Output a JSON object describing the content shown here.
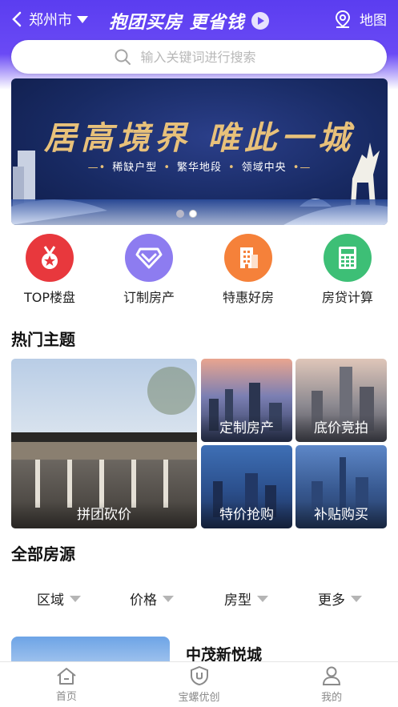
{
  "header": {
    "city": "郑州市",
    "slogan": "抱团买房 更省钱",
    "map_label": "地图"
  },
  "search": {
    "placeholder": "输入关键词进行搜索"
  },
  "banner": {
    "title": "居高境界 唯此一城",
    "tags": [
      "稀缺户型",
      "繁华地段",
      "领域中央"
    ],
    "slide_count": 2,
    "active_slide": 2
  },
  "quick_menu": [
    {
      "label": "TOP楼盘",
      "icon": "medal-icon",
      "color": "#e8383d"
    },
    {
      "label": "订制房产",
      "icon": "diamond-icon",
      "color": "#8d7cf0"
    },
    {
      "label": "特惠好房",
      "icon": "building-icon",
      "color": "#f5813a"
    },
    {
      "label": "房贷计算",
      "icon": "calculator-icon",
      "color": "#3dbf76"
    }
  ],
  "hot_topics": {
    "title": "热门主题",
    "items": [
      {
        "label": "拼团砍价"
      },
      {
        "label": "定制房产"
      },
      {
        "label": "底价竞拍"
      },
      {
        "label": "特价抢购"
      },
      {
        "label": "补贴购买"
      }
    ]
  },
  "all_listings": {
    "title": "全部房源",
    "filters": [
      "区域",
      "价格",
      "房型",
      "更多"
    ],
    "first_listing": {
      "name": "中茂新悦城"
    }
  },
  "tabbar": [
    {
      "label": "首页",
      "icon": "home-icon"
    },
    {
      "label": "宝螺优创",
      "icon": "shield-icon"
    },
    {
      "label": "我的",
      "icon": "user-icon"
    }
  ],
  "colors": {
    "brand": "#5b3df0",
    "banner_gold": "#e8c17a"
  }
}
